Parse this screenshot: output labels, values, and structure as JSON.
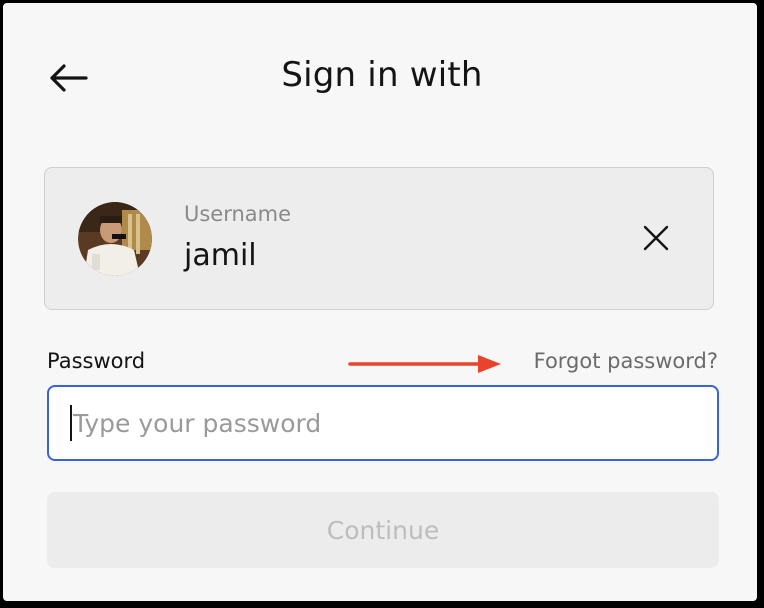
{
  "header": {
    "title": "Sign in with",
    "back_icon": "arrow-left-icon"
  },
  "account": {
    "username_label": "Username",
    "username": "jamil",
    "clear_icon": "close-icon",
    "avatar_icon": "user-avatar"
  },
  "password": {
    "label": "Password",
    "placeholder": "Type your password",
    "value": "",
    "forgot_link": "Forgot password?"
  },
  "continue_button": {
    "label": "Continue",
    "enabled": false
  },
  "annotation": {
    "arrow_color": "#e8432b",
    "icon": "arrow-right-icon"
  },
  "colors": {
    "focus_border": "#3a63d8",
    "background": "#f7f7f7",
    "card": "#ededed"
  }
}
